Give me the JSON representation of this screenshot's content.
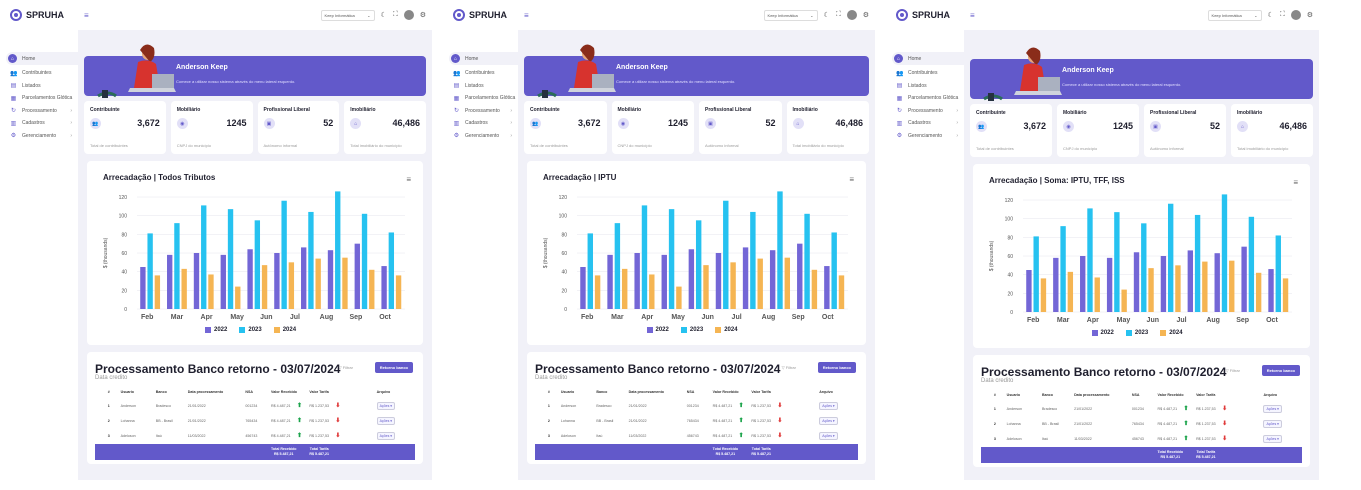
{
  "app": {
    "logo": "SPRUHA"
  },
  "topbar": {
    "select_value": "Keep Informática",
    "select_caret": "⌄",
    "icons": [
      "moon-icon",
      "fullscreen-icon",
      "avatar",
      "gear-icon"
    ]
  },
  "sidebar": {
    "items": [
      {
        "label": "Home",
        "icon": "home-icon",
        "glyph": "⌂",
        "active": true
      },
      {
        "label": "Contribuintes",
        "icon": "users-icon",
        "glyph": "👥",
        "chevron": false
      },
      {
        "label": "Listados",
        "icon": "document-icon",
        "glyph": "▤",
        "chevron": false
      },
      {
        "label": "Parcelamentos Glótica",
        "icon": "table-icon",
        "glyph": "▦",
        "chevron": false
      },
      {
        "label": "Processamento",
        "icon": "refresh-icon",
        "glyph": "↻",
        "chevron": true
      },
      {
        "label": "Cadastros",
        "icon": "file-icon",
        "glyph": "▥",
        "chevron": true
      },
      {
        "label": "Gerenciamento",
        "icon": "user-gear-icon",
        "glyph": "⚙",
        "chevron": true
      }
    ]
  },
  "banner": {
    "name": "Anderson Keep",
    "subtitle": "Comece a utilizar nosso sistema através do menu lateral esquerdo."
  },
  "stats": [
    {
      "title": "Contribuinte",
      "value": "3,672",
      "subtitle": "Total de contribuintes",
      "icon": "users-icon",
      "glyph": "👥"
    },
    {
      "title": "Mobiliário",
      "value": "1245",
      "subtitle": "CNPJ do município",
      "icon": "building-icon",
      "glyph": "◉"
    },
    {
      "title": "Profissional Liberal",
      "value": "52",
      "subtitle": "Autônomo informal",
      "icon": "briefcase-icon",
      "glyph": "▣"
    },
    {
      "title": "Imobiliário",
      "value": "46,486",
      "subtitle": "Total imobiliário do município",
      "icon": "home-icon",
      "glyph": "⌂"
    }
  ],
  "colors": {
    "accent": "#6259ca",
    "s2022": "#7366d6",
    "s2023": "#26c2f0",
    "s2024": "#f5b553"
  },
  "charts": [
    {
      "title": "Arrecadação | Todos Tributos",
      "chart_data": {
        "type": "bar",
        "categories": [
          "Feb",
          "Mar",
          "Apr",
          "May",
          "Jun",
          "Jul",
          "Aug",
          "Sep",
          "Oct"
        ],
        "ylabel": "$ (thousands)",
        "ylim": [
          0,
          120
        ],
        "yticks": [
          0,
          20,
          40,
          60,
          80,
          100,
          120
        ],
        "series": [
          {
            "name": "2022",
            "values": [
              45,
              58,
              60,
              58,
              64,
              60,
              66,
              63,
              70,
              46
            ]
          },
          {
            "name": "2023",
            "values": [
              81,
              92,
              111,
              107,
              95,
              116,
              104,
              126,
              102,
              82
            ]
          },
          {
            "name": "2024",
            "values": [
              36,
              43,
              37,
              24,
              47,
              50,
              54,
              55,
              42,
              36
            ]
          }
        ],
        "grid": true,
        "legend": "bottom"
      }
    },
    {
      "title": "Arrecadação | IPTU",
      "chart_data": {
        "type": "bar",
        "categories": [
          "Feb",
          "Mar",
          "Apr",
          "May",
          "Jun",
          "Jul",
          "Aug",
          "Sep",
          "Oct"
        ],
        "ylabel": "$ (thousands)",
        "ylim": [
          0,
          120
        ],
        "yticks": [
          0,
          20,
          40,
          60,
          80,
          100,
          120
        ],
        "series": [
          {
            "name": "2022",
            "values": [
              45,
              58,
              60,
              58,
              64,
              60,
              66,
              63,
              70,
              46
            ]
          },
          {
            "name": "2023",
            "values": [
              81,
              92,
              111,
              107,
              95,
              116,
              104,
              126,
              102,
              82
            ]
          },
          {
            "name": "2024",
            "values": [
              36,
              43,
              37,
              24,
              47,
              50,
              54,
              55,
              42,
              36
            ]
          }
        ],
        "grid": true,
        "legend": "bottom"
      }
    },
    {
      "title": "Arrecadação | Soma: IPTU, TFF, ISS",
      "chart_data": {
        "type": "bar",
        "categories": [
          "Feb",
          "Mar",
          "Apr",
          "May",
          "Jun",
          "Jul",
          "Aug",
          "Sep",
          "Oct"
        ],
        "ylabel": "$ (thousands)",
        "ylim": [
          0,
          120
        ],
        "yticks": [
          0,
          20,
          40,
          60,
          80,
          100,
          120
        ],
        "series": [
          {
            "name": "2022",
            "values": [
              45,
              58,
              60,
              58,
              64,
              60,
              66,
              63,
              70,
              46
            ]
          },
          {
            "name": "2023",
            "values": [
              81,
              92,
              111,
              107,
              95,
              116,
              104,
              126,
              102,
              82
            ]
          },
          {
            "name": "2024",
            "values": [
              36,
              43,
              37,
              24,
              47,
              50,
              54,
              55,
              42,
              36
            ]
          }
        ],
        "grid": true,
        "legend": "bottom"
      }
    }
  ],
  "processing": {
    "title": "Processamento Banco retorno - 03/07/2024",
    "subtitle": "Data credito",
    "filter_label": "▽ Filtrar",
    "button_label": "Retorno banco",
    "headers": [
      "#",
      "Usuario",
      "Banco",
      "Data processamento",
      "NSA",
      "Valor Recebido",
      "Valor Tarifa",
      "Arquivo"
    ],
    "rows": [
      {
        "n": "1",
        "user": "Anderson",
        "bank": "Bradesco",
        "date": "21/01/2022",
        "nsa": "001234",
        "recv": "R$ 4.487,21",
        "fee": "R$ 1.237,53",
        "action": "Ações ▾"
      },
      {
        "n": "2",
        "user": "Lohanna",
        "bank": "BB - Brasil",
        "date": "21/01/2022",
        "nsa": "765434",
        "recv": "R$ 4.487,21",
        "fee": "R$ 1.237,53",
        "action": "Ações ▾"
      },
      {
        "n": "3",
        "user": "Adeloson",
        "bank": "Itaú",
        "date": "11/03/2022",
        "nsa": "456743",
        "recv": "R$ 4.487,21",
        "fee": "R$ 1.237,53",
        "action": "Ações ▾"
      }
    ],
    "total_recv_label": "Total Recebido",
    "total_recv": "R$ 5.487,21",
    "total_fee_label": "Total Tarifa",
    "total_fee": "R$ 5.487,21",
    "arrow_up": "⬆",
    "arrow_down": "⬇"
  }
}
